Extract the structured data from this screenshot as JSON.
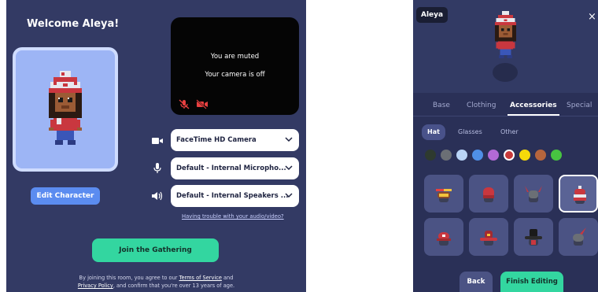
{
  "lobby": {
    "title": "Welcome Aleya!",
    "edit_label": "Edit Character",
    "video": {
      "muted_text": "You are muted",
      "camera_off_text": "Your camera is off"
    },
    "devices": {
      "camera": "FaceTime HD Camera",
      "microphone": "Default - Internal Micropho...",
      "speakers": "Default - Internal Speakers ..."
    },
    "trouble_link": "Having trouble with your audio/video?",
    "join_label": "Join the Gathering",
    "legal": {
      "prefix": "By joining this room, you agree to our ",
      "tos": "Terms of Service",
      "and": " and",
      "privacy": "Privacy Policy",
      "suffix": ", and confirm that you're over 13 years of age."
    }
  },
  "editor": {
    "name": "Aleya",
    "close_glyph": "×",
    "tabs": [
      {
        "label": "Base"
      },
      {
        "label": "Clothing"
      },
      {
        "label": "Accessories",
        "active": true
      },
      {
        "label": "Special"
      }
    ],
    "subtabs": [
      {
        "label": "Hat",
        "active": true
      },
      {
        "label": "Glasses"
      },
      {
        "label": "Other"
      }
    ],
    "swatches": [
      "#2e3a2f",
      "#6b6f75",
      "#b9d4f7",
      "#4f8fe6",
      "#b36ad6",
      "#c73a3a",
      "#f5d90a",
      "#b5653d",
      "#47c441"
    ],
    "selected_swatch": 5,
    "items": [
      {
        "icon": "beanie-propeller-icon"
      },
      {
        "icon": "red-beanie-icon"
      },
      {
        "icon": "viking-horns-icon"
      },
      {
        "icon": "pompom-beanie-icon",
        "selected": true
      },
      {
        "icon": "red-cap-icon"
      },
      {
        "icon": "cowboy-hat-icon"
      },
      {
        "icon": "black-hat-icon"
      },
      {
        "icon": "feather-hat-icon"
      }
    ],
    "back_label": "Back",
    "finish_label": "Finish Editing"
  }
}
